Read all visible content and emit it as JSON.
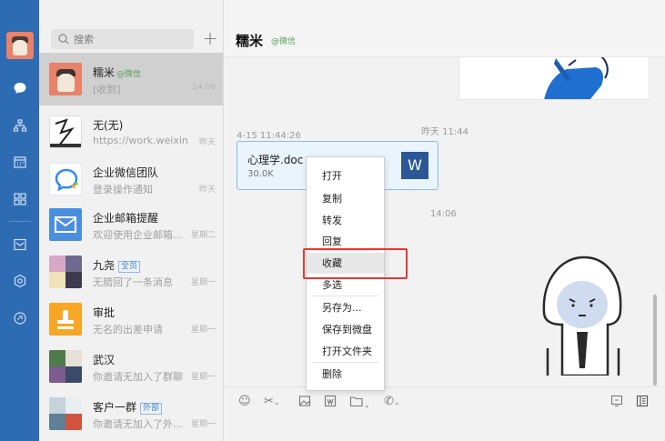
{
  "search": {
    "placeholder": "搜索"
  },
  "conversations": [
    {
      "name": "糯米",
      "tag": "@微信",
      "preview": "[收到]",
      "time": "14:06"
    },
    {
      "name": "无(无)",
      "preview": "https://work.weixin....",
      "time": "昨天"
    },
    {
      "name": "企业微信团队",
      "preview": "登录操作通知",
      "time": "昨天"
    },
    {
      "name": "企业邮箱提醒",
      "preview": "欢迎使用企业邮箱...",
      "time": "星期二"
    },
    {
      "name": "九尧",
      "badge": "全员",
      "preview": "无腊回了一条消息",
      "time": "星期一"
    },
    {
      "name": "审批",
      "preview": "无名的出差申请",
      "time": "星期一"
    },
    {
      "name": "武汉",
      "preview": "你邀请无加入了群聊",
      "time": "星期一"
    },
    {
      "name": "客户一群",
      "badge": "外部",
      "preview": "你邀请无加入了外...",
      "time": "星期一"
    }
  ],
  "chat": {
    "title": "糯米",
    "tag": "@微信",
    "timestamps": {
      "yesterday": "昨天 11:44",
      "file_sent": "4-15 11:44:26",
      "today": "14:06"
    },
    "file": {
      "name": "心理学.doc",
      "size": "30.0K",
      "icon_letter": "W"
    }
  },
  "context_menu": {
    "items": [
      "打开",
      "复制",
      "转发",
      "回复",
      "收藏",
      "多选",
      "另存为...",
      "保存到微盘",
      "打开文件夹",
      "删除"
    ],
    "highlighted": "收藏"
  },
  "icons": {
    "rail": [
      "chat-bubble-icon",
      "org-chart-icon",
      "calendar-icon",
      "apps-grid-icon",
      "mail-icon",
      "cube-icon",
      "link-icon"
    ],
    "toolbar": [
      "emoji-icon",
      "scissors-icon",
      "image-icon",
      "word-file-icon",
      "folder-icon",
      "phone-icon",
      "screenshot-icon",
      "history-icon"
    ]
  },
  "colors": {
    "rail": "#2d6bb3",
    "file_card": "#eaf4fd",
    "highlight": "#e53935",
    "word": "#2b5797"
  }
}
